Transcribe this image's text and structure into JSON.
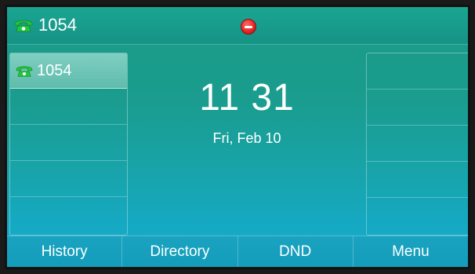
{
  "status_bar": {
    "account_label": "1054",
    "account_icon": "phone-icon",
    "dnd_icon": "dnd-icon",
    "colors": {
      "phone_icon": "#22c83a",
      "dnd": "#e22222"
    }
  },
  "line_keys_left": [
    {
      "label": "1054",
      "icon": "phone-icon",
      "active": true
    },
    {
      "label": ""
    },
    {
      "label": ""
    },
    {
      "label": ""
    },
    {
      "label": ""
    }
  ],
  "line_keys_right": [
    {
      "label": ""
    },
    {
      "label": ""
    },
    {
      "label": ""
    },
    {
      "label": ""
    },
    {
      "label": ""
    }
  ],
  "idle": {
    "time": "11 31",
    "date": "Fri, Feb 10"
  },
  "softkeys": [
    {
      "label": "History"
    },
    {
      "label": "Directory"
    },
    {
      "label": "DND"
    },
    {
      "label": "Menu"
    }
  ]
}
